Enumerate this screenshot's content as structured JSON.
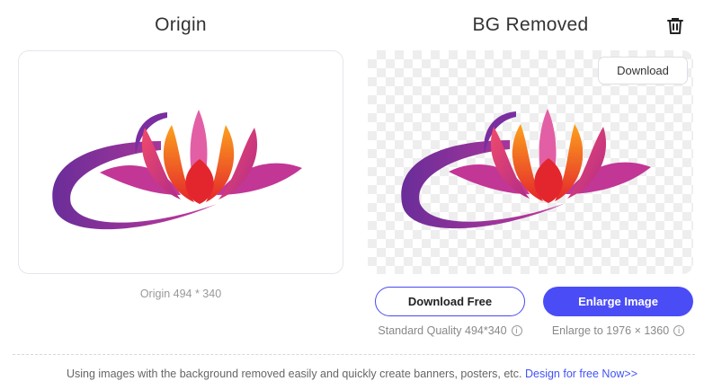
{
  "origin": {
    "title": "Origin",
    "caption": "Origin 494 * 340"
  },
  "removed": {
    "title": "BG Removed",
    "download_label": "Download"
  },
  "actions": {
    "download_free_label": "Download Free",
    "enlarge_label": "Enlarge Image",
    "standard_quality": "Standard Quality 494*340",
    "enlarge_to": "Enlarge to 1976 × 1360"
  },
  "footer": {
    "text": "Using images with the background removed easily and quickly create banners, posters, etc.",
    "link": "Design for free Now>>"
  },
  "colors": {
    "accent": "#4a4cf6",
    "link": "#4152f5"
  }
}
